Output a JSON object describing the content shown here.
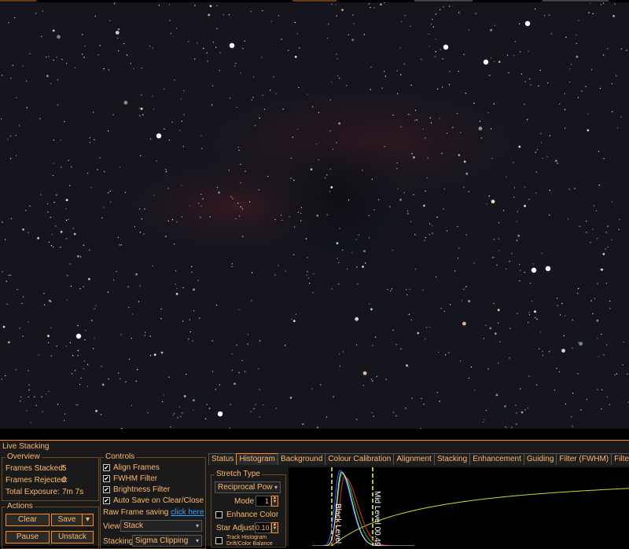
{
  "panel_title": "Live Stacking",
  "overview": {
    "legend": "Overview",
    "stacked_label": "Frames Stacked:",
    "stacked_value": "5",
    "rejected_label": "Frames Rejected:",
    "rejected_value": "0",
    "exposure_label": "Total Exposure:",
    "exposure_value": "7m 7s"
  },
  "actions": {
    "legend": "Actions",
    "clear": "Clear",
    "save": "Save",
    "pause": "Pause",
    "unstack": "Unstack"
  },
  "controls": {
    "legend": "Controls",
    "align_frames": "Align Frames",
    "fwhm_filter": "FWHM Filter",
    "brightness_filter": "Brightness Filter",
    "auto_save": "Auto Save on Clear/Close",
    "raw_saving": "Raw Frame saving",
    "raw_link": "click here",
    "view_label": "View",
    "view_value": "Stack",
    "stacking_label": "Stacking",
    "stacking_value": "Sigma Clipping"
  },
  "tabs": [
    "Status",
    "Histogram",
    "Background",
    "Colour Calibration",
    "Alignment",
    "Stacking",
    "Enhancement",
    "Guiding",
    "Filter (FWHM)",
    "Filter (Brigh"
  ],
  "active_tab": 1,
  "stretch": {
    "legend": "Stretch Type",
    "type_value": "Reciprocal Pow",
    "mode_label": "Mode",
    "mode_value": "1",
    "enhance_color": "Enhance Color",
    "star_adjust_label": "Star Adjust",
    "star_adjust_value": "0.10",
    "track_histogram": "Track Histogram",
    "drift_balance": "Drift/Color Balance"
  },
  "histogram": {
    "black_level_label": "Black Level  0",
    "mid_level_label": "Mid Level  00.4933",
    "colors": {
      "red": "#e03030",
      "green": "#30c030",
      "blue": "#3060ff",
      "lum": "#e0e0e0",
      "curve": "#d8d820",
      "marker": "#ffff40"
    }
  },
  "colors": {
    "accent": "#ff8a1a",
    "text": "#ffb86b",
    "link": "#3aa0ff"
  }
}
